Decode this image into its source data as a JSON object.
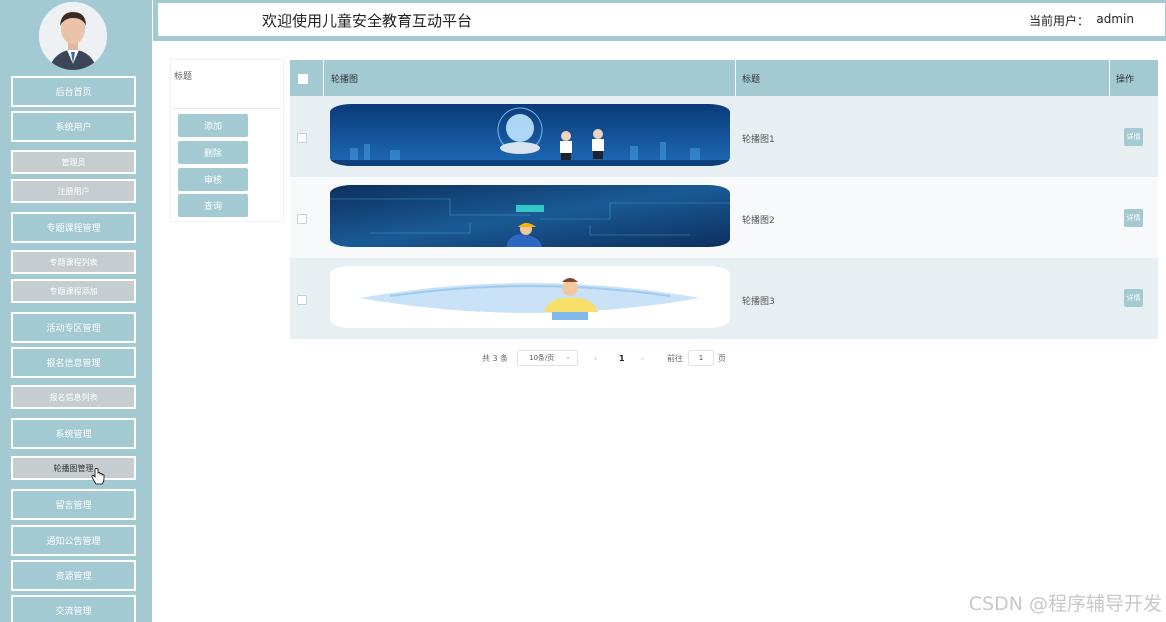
{
  "header": {
    "title": "欢迎使用儿童安全教育互动平台",
    "current_user_label": "当前用户：",
    "current_user": "admin"
  },
  "sidebar": {
    "items": [
      {
        "label": "后台首页",
        "kind": "main"
      },
      {
        "label": "系统用户",
        "kind": "main"
      },
      {
        "label": "管理员",
        "kind": "sub"
      },
      {
        "label": "注册用户",
        "kind": "sub"
      },
      {
        "label": "专题课程管理",
        "kind": "main"
      },
      {
        "label": "专题课程列表",
        "kind": "sub"
      },
      {
        "label": "专题课程添加",
        "kind": "sub"
      },
      {
        "label": "活动专区管理",
        "kind": "main"
      },
      {
        "label": "报名信息管理",
        "kind": "main"
      },
      {
        "label": "报名信息列表",
        "kind": "sub"
      },
      {
        "label": "系统管理",
        "kind": "main"
      },
      {
        "label": "轮播图管理",
        "kind": "sub",
        "active": true
      },
      {
        "label": "留言管理",
        "kind": "main"
      },
      {
        "label": "通知公告管理",
        "kind": "main"
      },
      {
        "label": "资源管理",
        "kind": "main"
      },
      {
        "label": "交流管理",
        "kind": "main"
      }
    ]
  },
  "search": {
    "label": "标题",
    "value": "",
    "buttons": {
      "add": "添加",
      "delete": "删除",
      "review": "审核",
      "query": "查询"
    }
  },
  "table": {
    "columns": {
      "image": "轮播图",
      "title": "标题",
      "action": "操作"
    },
    "rows": [
      {
        "title": "轮播图1",
        "action": "详情"
      },
      {
        "title": "轮播图2",
        "action": "详情"
      },
      {
        "title": "轮播图3",
        "action": "详情"
      }
    ]
  },
  "pagination": {
    "total": "共 3 条",
    "page_size": "10条/页",
    "current_page": "1",
    "jump_label": "前往",
    "jump_value": "1",
    "page_unit": "页"
  },
  "watermark": "CSDN @程序辅导开发",
  "colors": {
    "accent": "#a3c9d3",
    "sub_nav": "#c5cdd0",
    "row_odd": "#e7eff2"
  }
}
